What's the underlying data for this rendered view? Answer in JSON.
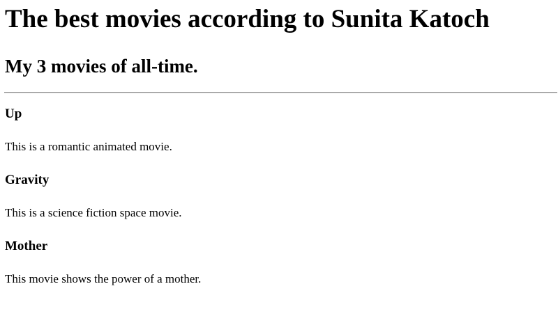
{
  "page": {
    "title": "The best movies according to Sunita Katoch",
    "subtitle": "My 3 movies of all-time."
  },
  "movies": [
    {
      "title": "Up",
      "description": "This is a romantic animated movie."
    },
    {
      "title": "Gravity",
      "description": "This is a science fiction space movie."
    },
    {
      "title": "Mother",
      "description": "This movie shows the power of a mother."
    }
  ]
}
